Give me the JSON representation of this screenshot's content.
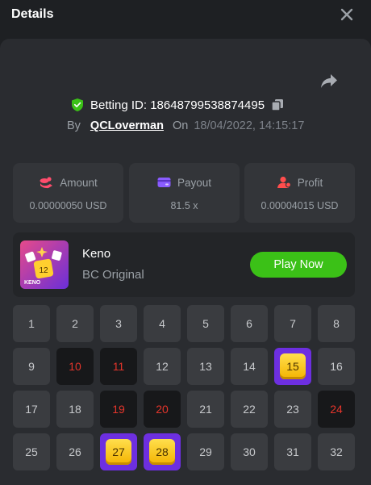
{
  "header": {
    "title": "Details"
  },
  "bet": {
    "id_label": "Betting ID:",
    "id_value": "18648799538874495",
    "by_label": "By",
    "user": "QCLoverman",
    "on_label": "On",
    "datetime": "18/04/2022, 14:15:17"
  },
  "stats": [
    {
      "label": "Amount",
      "value": "0.00000050 USD",
      "icon": "coins-icon",
      "color": "#ff4d6d"
    },
    {
      "label": "Payout",
      "value": "81.5 x",
      "icon": "wallet-icon",
      "color": "#8a5cff"
    },
    {
      "label": "Profit",
      "value": "0.00004015 USD",
      "icon": "user-profit-icon",
      "color": "#ff4d4d"
    }
  ],
  "game": {
    "name": "Keno",
    "provider": "BC Original",
    "thumb_label": "KENO",
    "thumb_number": "12",
    "play_label": "Play Now"
  },
  "colors": {
    "accent_green": "#3bc117",
    "hit_purple": "#6d2fe0",
    "miss_red": "#e5352b"
  },
  "board": {
    "numbers": [
      "1",
      "2",
      "3",
      "4",
      "5",
      "6",
      "7",
      "8",
      "9",
      "10",
      "11",
      "12",
      "13",
      "14",
      "15",
      "16",
      "17",
      "18",
      "19",
      "20",
      "21",
      "22",
      "23",
      "24",
      "25",
      "26",
      "27",
      "28",
      "29",
      "30",
      "31",
      "32"
    ],
    "hits": [
      "15",
      "27",
      "28"
    ],
    "misses": [
      "10",
      "11",
      "19",
      "20",
      "24"
    ]
  }
}
